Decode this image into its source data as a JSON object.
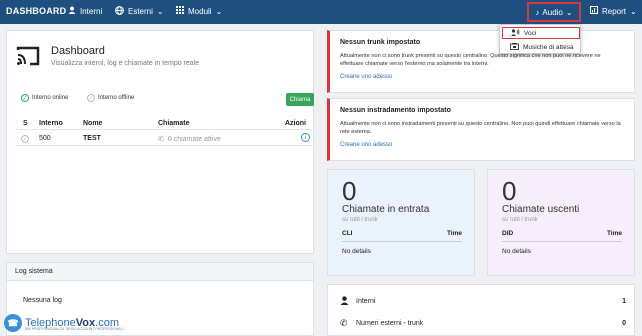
{
  "nav": {
    "brand": "DASHBOARD",
    "items": [
      {
        "label": "Interni",
        "icon": "user-icon"
      },
      {
        "label": "Esterni",
        "icon": "globe-icon"
      },
      {
        "label": "Moduli",
        "icon": "grid-icon"
      }
    ],
    "audio": {
      "label": "Audio",
      "icon": "music-note-icon"
    },
    "report": {
      "label": "Report",
      "icon": "chart-icon"
    },
    "audio_menu": [
      {
        "label": "Voci",
        "icon": "voice-icon"
      },
      {
        "label": "Musiche di attesa",
        "icon": "hold-music-icon"
      }
    ]
  },
  "dashboard": {
    "title": "Dashboard",
    "subtitle": "Visualizza interni, log e chiamate in tempo reale",
    "legend_online": "Interno online",
    "legend_offline": "Interno offline",
    "call_button": "Chiama",
    "table": {
      "headers": [
        "S",
        "Interno",
        "Nome",
        "Chiamate",
        "Azioni"
      ],
      "rows": [
        {
          "interno": "500",
          "nome": "TEST",
          "chiamate": "0 chiamate attive"
        }
      ]
    }
  },
  "log": {
    "title": "Log sistema",
    "empty": "Nessuna log"
  },
  "alerts": [
    {
      "title": "Nessun trunk impostato",
      "text": "Attualmente non ci sono trunk presenti su questo centralino. Questo significa che non puoi ne ricevere ne effettuare chiamate verso l'esterno ma solamente tra interni.",
      "link": "Creane uno adesso"
    },
    {
      "title": "Nessun instradamento impostato",
      "text": "Attualmente non ci sono instradamenti presenti su questo centralino. Non puoi quindi effettuare chiamate verso la rete esterna.",
      "link": "Creane uno adesso"
    }
  ],
  "stats": {
    "incoming": {
      "count": "0",
      "label": "Chiamate in entrata",
      "sub": "su tutti i trunk",
      "col1": "CLI",
      "col2": "Time",
      "empty": "No details"
    },
    "outgoing": {
      "count": "0",
      "label": "Chiamate uscenti",
      "sub": "su tutti i trunk",
      "col1": "DID",
      "col2": "Time",
      "empty": "No details"
    }
  },
  "counts": [
    {
      "label": "Interni",
      "value": "1",
      "icon": "user-icon"
    },
    {
      "label": "Numeri esterni - trunk",
      "value": "0",
      "icon": "phone-icon"
    }
  ],
  "watermark": {
    "brand_a": "Telephone",
    "brand_b": "Vox",
    "brand_c": ".com",
    "tagline": "800 PROFESSIONALITA' DEGLI ACCOUNT PROFESSIONALI"
  },
  "colors": {
    "topbar": "#1f4f7f",
    "accent_red": "#d9363e",
    "green": "#3aa35a",
    "link_blue": "#2b6cb0"
  }
}
